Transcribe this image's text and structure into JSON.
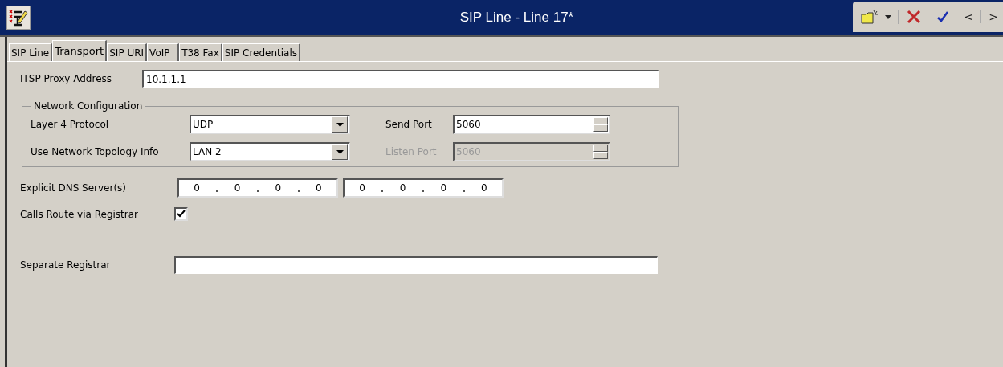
{
  "window": {
    "title": "SIP Line - Line 17*"
  },
  "toolbar": {
    "items": [
      {
        "kind": "new"
      },
      {
        "kind": "dropdown"
      },
      {
        "kind": "cancel"
      },
      {
        "kind": "ok"
      },
      {
        "kind": "text",
        "label": "<"
      },
      {
        "kind": "text",
        "label": ">"
      }
    ]
  },
  "tabs": [
    {
      "label": "SIP Line",
      "selected": false
    },
    {
      "label": "Transport",
      "selected": true
    },
    {
      "label": "SIP URI",
      "selected": false
    },
    {
      "label": "VoIP  ",
      "selected": false
    },
    {
      "label": "T38 Fax",
      "selected": false
    },
    {
      "label": "SIP Credentials",
      "selected": false
    }
  ],
  "itsp_proxy_address": {
    "label": "ITSP Proxy Address",
    "value": "10.1.1.1"
  },
  "network_configuration": {
    "legend": "Network Configuration",
    "layer4_protocol": {
      "label": "Layer 4 Protocol",
      "value": "UDP"
    },
    "network_topology": {
      "label": "Use Network Topology Info",
      "value": "LAN 2"
    },
    "send_port": {
      "label": "Send Port",
      "value": "5060",
      "disabled": false
    },
    "listen_port": {
      "label": "Listen Port",
      "value": "5060",
      "disabled": true
    }
  },
  "explicit_dns_servers": {
    "label": "Explicit DNS Server(s)",
    "addresses": [
      [
        "0",
        "0",
        "0",
        "0"
      ],
      [
        "0",
        "0",
        "0",
        "0"
      ]
    ]
  },
  "calls_route_via_registrar": {
    "label": "Calls Route via Registrar",
    "checked": true
  },
  "separate_registrar": {
    "label": "Separate Registrar"
  }
}
